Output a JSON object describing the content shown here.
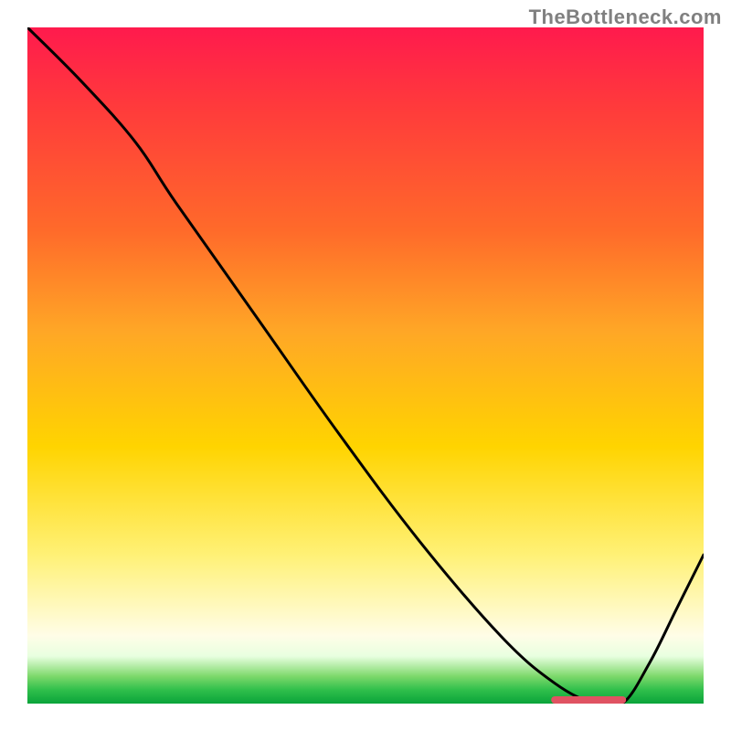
{
  "watermark": "TheBottleneck.com",
  "chart_data": {
    "type": "line",
    "title": "",
    "xlabel": "",
    "ylabel": "",
    "xlim": [
      0,
      100
    ],
    "ylim": [
      0,
      100
    ],
    "grid": false,
    "legend": false,
    "series": [
      {
        "name": "bottleneck-curve",
        "color": "#000000",
        "x": [
          0,
          8,
          16,
          22,
          34,
          46,
          58,
          70,
          78,
          84,
          88,
          92,
          96,
          100
        ],
        "y": [
          100,
          92,
          83,
          74,
          57,
          40,
          24,
          10,
          3,
          0,
          0,
          6,
          14,
          22
        ]
      }
    ],
    "annotations": [
      {
        "name": "optimal-range-marker",
        "type": "segment",
        "color": "#e05362",
        "x0": 78,
        "x1": 88,
        "y": 0
      }
    ],
    "background_gradient": {
      "direction": "vertical",
      "stops": [
        {
          "pos": 0.0,
          "color": "#ff1a4d"
        },
        {
          "pos": 0.12,
          "color": "#ff3b3b"
        },
        {
          "pos": 0.3,
          "color": "#ff6a2a"
        },
        {
          "pos": 0.45,
          "color": "#ffa726"
        },
        {
          "pos": 0.62,
          "color": "#ffd400"
        },
        {
          "pos": 0.78,
          "color": "#fff176"
        },
        {
          "pos": 0.9,
          "color": "#fffde7"
        },
        {
          "pos": 0.93,
          "color": "#e8ffe0"
        },
        {
          "pos": 0.96,
          "color": "#7cd86a"
        },
        {
          "pos": 0.98,
          "color": "#2fbf4b"
        },
        {
          "pos": 1.0,
          "color": "#0aa33a"
        }
      ]
    }
  }
}
